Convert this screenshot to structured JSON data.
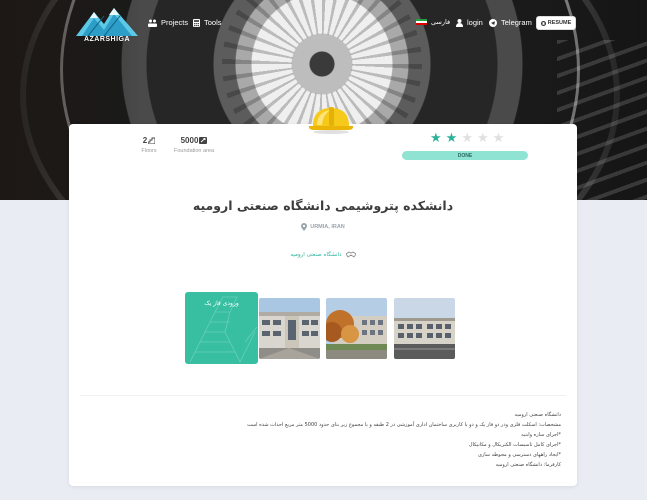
{
  "nav": {
    "brand": "AZARSHIGA",
    "projects": "Projects",
    "tools": "Tools",
    "language": "فارسی",
    "login": "login",
    "telegram": "Telegram",
    "resume": "RESUME"
  },
  "project": {
    "floors_value": "2",
    "floors_label": "Floors",
    "area_value": "5000",
    "area_label": "Foundation area",
    "rating": 2,
    "rating_max": 5,
    "status": "DONE",
    "title": "دانشکده پتروشیمی دانشگاه صنعتی ارومیه",
    "location": "URMIA, IRAN",
    "client": "دانشگاه صنعتی ارومیه",
    "phase_label": "ورودی فاز یک"
  },
  "description": [
    "دانشگاه صنعتی ارومیه",
    "مشخصات: اسکلت فلزی ودر دو فاز یک و دو با کاربری ساختمان اداری آموزشی در 2 طبقه و با مجموع زیر بنای حدود 5000 متر مربع احداث شده است",
    "*اجرای سازه وابنیه",
    "*اجرای کامل تاسیسات الکتریکال و مکانیکال",
    "*ایجاد راههای دسترسی و محوطه سازی",
    "کارفرما: دانشگاه صنعتی ارومیه"
  ],
  "colors": {
    "accent": "#38bfa2",
    "status_pill": "#8fe3d3",
    "star_on": "#2bb39a",
    "star_off": "#e0e0e0"
  },
  "icons": {
    "projects": "projects-icon",
    "tools": "calculator-icon",
    "login": "user-icon",
    "telegram": "telegram-icon",
    "resume": "document-icon",
    "floors": "stairs-icon",
    "area": "area-icon",
    "location": "map-pin-icon",
    "client": "handshake-icon"
  }
}
